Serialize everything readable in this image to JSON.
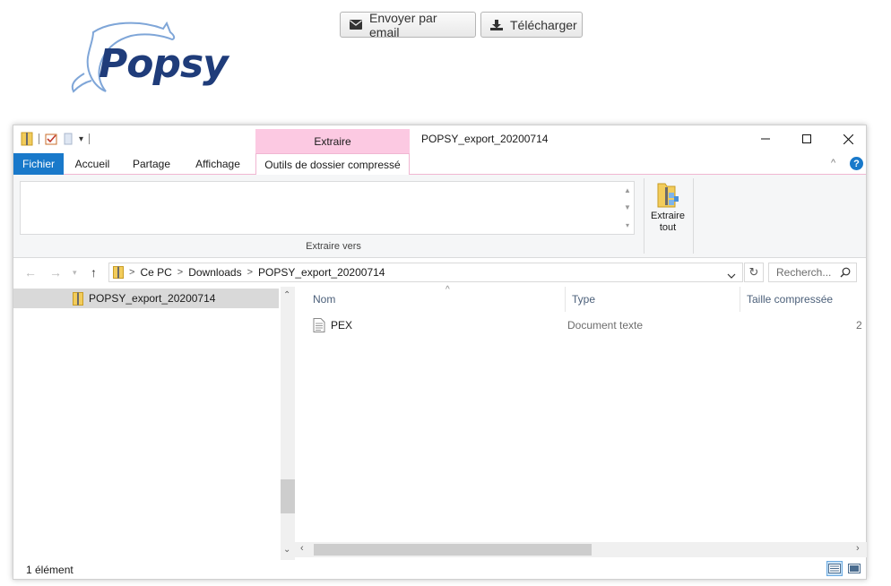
{
  "header": {
    "logo_text": "Popsy",
    "email_button": "Envoyer par email",
    "download_button": "Télécharger"
  },
  "window": {
    "title": "POPSY_export_20200714",
    "context_tab": "Extraire",
    "tabs": [
      "Fichier",
      "Accueil",
      "Partage",
      "Affichage",
      "Outils de dossier compressé"
    ],
    "help": "?"
  },
  "ribbon": {
    "group_label": "Extraire vers",
    "extract_all_line1": "Extraire",
    "extract_all_line2": "tout"
  },
  "address": {
    "crumbs": [
      "Ce PC",
      "Downloads",
      "POPSY_export_20200714"
    ],
    "search_placeholder": "Recherch..."
  },
  "nav_pane": {
    "selected_item": "POPSY_export_20200714"
  },
  "content": {
    "columns": [
      "Nom",
      "Type",
      "Taille compressée"
    ],
    "rows": [
      {
        "name": "PEX",
        "type": "Document texte",
        "size": "2"
      }
    ]
  },
  "status": {
    "count": "1 élément"
  },
  "colors": {
    "accent": "#1979ca",
    "context_pink": "#fcc9e2",
    "logo_blue": "#1f3c7a"
  }
}
